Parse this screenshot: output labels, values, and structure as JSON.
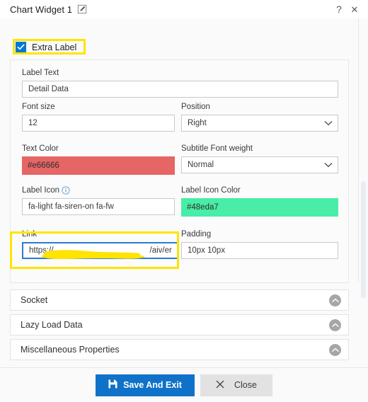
{
  "titlebar": {
    "title": "Chart Widget 1",
    "edit_icon": "edit-pencil-icon",
    "help_label": "?",
    "close_label": "✕"
  },
  "extra_label": {
    "label": "Extra Label",
    "checked": true,
    "highlight_color": "#ffe400"
  },
  "fields": {
    "label_text": {
      "label": "Label Text",
      "value": "Detail Data"
    },
    "font_size": {
      "label": "Font size",
      "value": "12"
    },
    "position": {
      "label": "Position",
      "value": "Right",
      "chevron": "chevron-down-icon"
    },
    "text_color": {
      "label": "Text Color",
      "value": "#e66666",
      "swatch": "#e66666"
    },
    "subtitle_font_weight": {
      "label": "Subtitle Font weight",
      "value": "Normal",
      "chevron": "chevron-down-icon"
    },
    "label_icon": {
      "label": "Label Icon",
      "value": "fa-light fa-siren-on fa-fw",
      "info_icon": "info-circle-icon"
    },
    "label_icon_color": {
      "label": "Label Icon Color",
      "value": "#48eda7",
      "swatch": "#48eda7"
    },
    "link": {
      "label": "Link",
      "value_prefix": "https://",
      "value_suffix": "/aiv/er",
      "redacted": true,
      "focused": true,
      "highlight_color": "#ffe400"
    },
    "padding": {
      "label": "Padding",
      "value": "10px 10px"
    }
  },
  "accordions": [
    {
      "label": "Socket",
      "chevron": "chevron-up-icon"
    },
    {
      "label": "Lazy Load Data",
      "chevron": "chevron-up-icon"
    },
    {
      "label": "Miscellaneous Properties",
      "chevron": "chevron-up-icon"
    }
  ],
  "footer": {
    "save_label": "Save And Exit",
    "save_icon": "save-floppy-icon",
    "close_label": "Close",
    "close_icon": "close-x-icon"
  },
  "colors": {
    "primary": "#0f72c8",
    "checkbox": "#0078d4",
    "highlight": "#ffe400",
    "focus_border": "#2b7cd3"
  }
}
